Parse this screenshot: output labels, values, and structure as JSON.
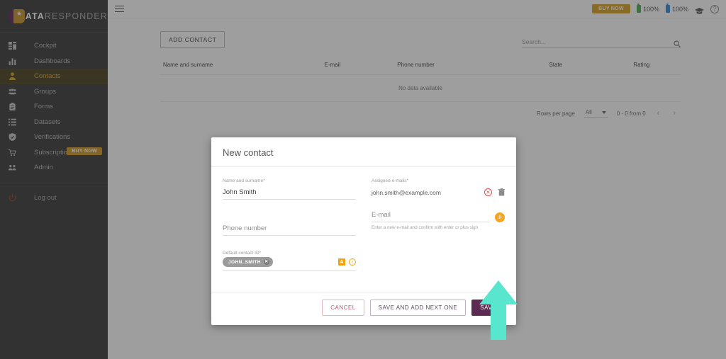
{
  "sidebar": {
    "logo": {
      "bold": "DATA",
      "light": "RESPONDER",
      "mark": "logo-mark-icon"
    },
    "items": [
      {
        "label": "Cockpit",
        "icon": "dashboard-grid-icon",
        "active": false
      },
      {
        "label": "Dashboards",
        "icon": "bar-chart-icon",
        "active": false
      },
      {
        "label": "Contacts",
        "icon": "person-icon",
        "active": true
      },
      {
        "label": "Groups",
        "icon": "people-group-icon",
        "active": false
      },
      {
        "label": "Forms",
        "icon": "clipboard-icon",
        "active": false
      },
      {
        "label": "Datasets",
        "icon": "list-icon",
        "active": false
      },
      {
        "label": "Verifications",
        "icon": "shield-check-icon",
        "active": false
      },
      {
        "label": "Subscription",
        "icon": "cart-icon",
        "active": false,
        "badge": "BUY NOW"
      },
      {
        "label": "Admin",
        "icon": "admin-people-icon",
        "active": false
      }
    ],
    "logout": {
      "label": "Log out",
      "icon": "power-icon"
    }
  },
  "topbar": {
    "menu_icon": "hamburger-icon",
    "buy_now": "BUY NOW",
    "meter_green": "100%",
    "meter_blue": "100%",
    "cap_icon": "graduation-cap-icon",
    "help_icon": "help-circle-icon"
  },
  "toolbar": {
    "add_contact": "ADD CONTACT",
    "search_placeholder": "Search...",
    "search_value": "",
    "search_icon": "search-icon"
  },
  "table": {
    "columns": [
      "Name and surname",
      "E-mail",
      "Phone number",
      "State",
      "Rating"
    ],
    "empty_message": "No data available",
    "rows": []
  },
  "paginator": {
    "rows_per_page_label": "Rows per page",
    "rows_per_page_value": "All",
    "range_label": "0 - 0 from 0",
    "prev_icon": "chevron-left-icon",
    "next_icon": "chevron-right-icon"
  },
  "dialog": {
    "title": "New contact",
    "name_label": "Name and surname*",
    "name_value": "John Smith",
    "phone_label": "",
    "phone_placeholder": "Phone number",
    "phone_value": "",
    "contact_id_label": "Default contact ID*",
    "contact_id_chip": "JOHN_SMITH",
    "chip_remove_icon": "close-circle-icon",
    "badge_a": "A",
    "info_icon": "info-circle-icon",
    "assigned_emails_label": "Assigned e-mails*",
    "assigned_email_value": "john.smith@example.com",
    "email_invalid_icon": "x-circle-icon",
    "email_delete_icon": "trash-icon",
    "email_placeholder": "E-mail",
    "email_value": "",
    "add_email_icon": "plus-circle-icon",
    "email_helper": "Enter a new e-mail and confirm with enter or plus sign",
    "buttons": {
      "cancel": "CANCEL",
      "save_and_next": "SAVE AND ADD NEXT ONE",
      "save": "SAVE"
    }
  },
  "annotation": {
    "arrow_icon": "up-arrow-annotation",
    "arrow_color": "#58e6cf",
    "points_at": "SAVE"
  },
  "colors": {
    "sidebar_bg": "#3b3b3b",
    "active_nav_bg": "#4c4020",
    "accent_gold": "#d6a62c",
    "primary_purple": "#5c2a52",
    "orange": "#f5a623",
    "danger_red": "#e34b4b",
    "teal_arrow": "#58e6cf"
  }
}
